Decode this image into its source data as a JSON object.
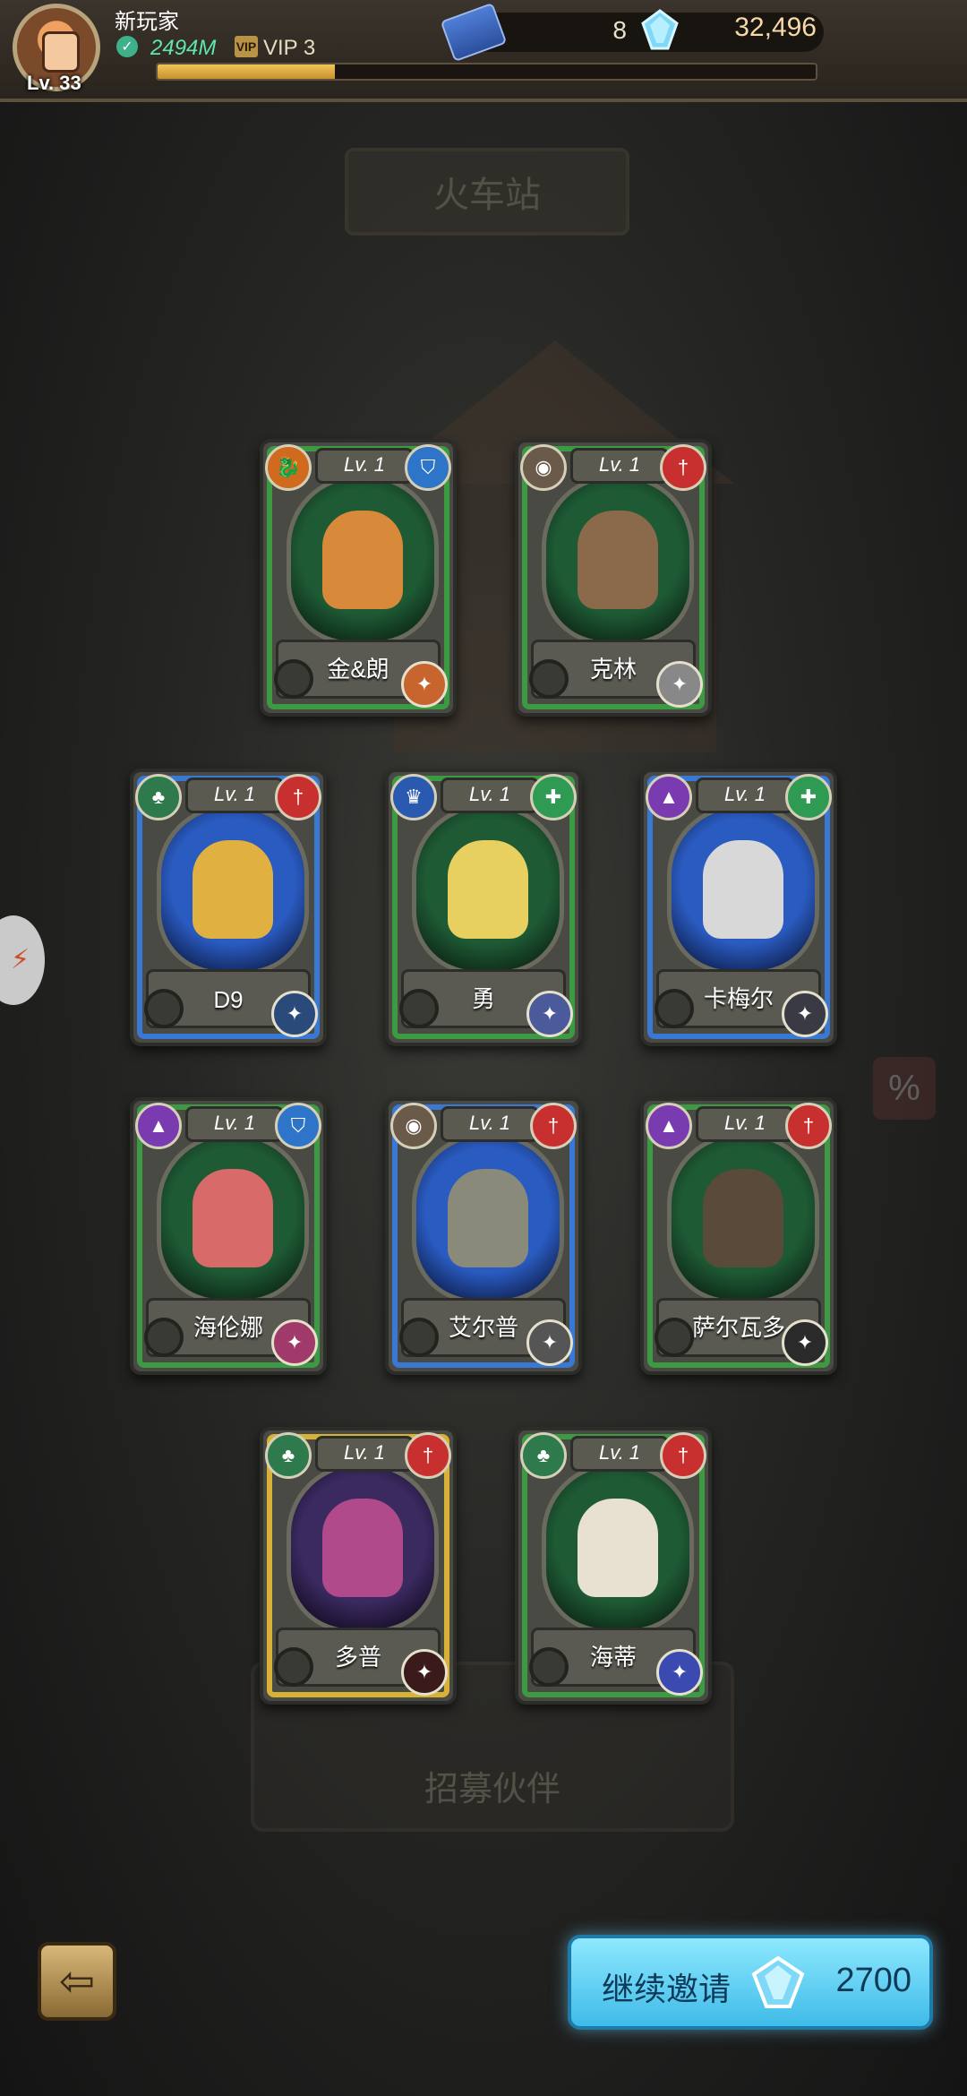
{
  "player": {
    "name": "新玩家",
    "level": "Lv. 33",
    "power": "2494M",
    "vip": "VIP 3",
    "xp_fraction": 0.27
  },
  "currency": {
    "tickets": "8",
    "gems": "32,496"
  },
  "background": {
    "station_sign": "火车站",
    "recruit_panel": "招募伙伴"
  },
  "cards": [
    {
      "name": "金&朗",
      "level": "Lv. 1",
      "frame": "green",
      "element": "dragon-icon",
      "role": "shield-icon",
      "skill": "fire-burst-icon"
    },
    {
      "name": "克林",
      "level": "Lv. 1",
      "frame": "green",
      "element": "eye-icon",
      "role": "sword-icon",
      "skill": "gear-icon"
    },
    {
      "name": "D9",
      "level": "Lv. 1",
      "frame": "blue",
      "element": "tree-icon",
      "role": "sword-icon",
      "skill": "lightning-icon"
    },
    {
      "name": "勇",
      "level": "Lv. 1",
      "frame": "green",
      "element": "crown-icon",
      "role": "heal-icon",
      "skill": "star-icon"
    },
    {
      "name": "卡梅尔",
      "level": "Lv. 1",
      "frame": "blue",
      "element": "spike-icon",
      "role": "heal-icon",
      "skill": "figure-icon"
    },
    {
      "name": "海伦娜",
      "level": "Lv. 1",
      "frame": "green",
      "element": "spike-icon",
      "role": "shield-icon",
      "skill": "swirl-icon"
    },
    {
      "name": "艾尔普",
      "level": "Lv. 1",
      "frame": "blue",
      "element": "eye-icon",
      "role": "sword-icon",
      "skill": "piano-icon"
    },
    {
      "name": "萨尔瓦多",
      "level": "Lv. 1",
      "frame": "green",
      "element": "spike-icon",
      "role": "sword-icon",
      "skill": "lamp-icon"
    },
    {
      "name": "多普",
      "level": "Lv. 1",
      "frame": "gold",
      "element": "tree-icon",
      "role": "sword-icon",
      "skill": "demon-icon"
    },
    {
      "name": "海蒂",
      "level": "Lv. 1",
      "frame": "green",
      "element": "tree-icon",
      "role": "sword-icon",
      "skill": "wave-icon"
    }
  ],
  "actions": {
    "back": "back-arrow-icon",
    "invite_label": "继续邀请",
    "invite_cost": "2700"
  },
  "colors": {
    "green_frame": "#3b9a42",
    "blue_frame": "#3a78d6",
    "gold_frame": "#d8b236",
    "gem_text": "#f5d9a8",
    "invite_bg": "#3fbbe8"
  }
}
